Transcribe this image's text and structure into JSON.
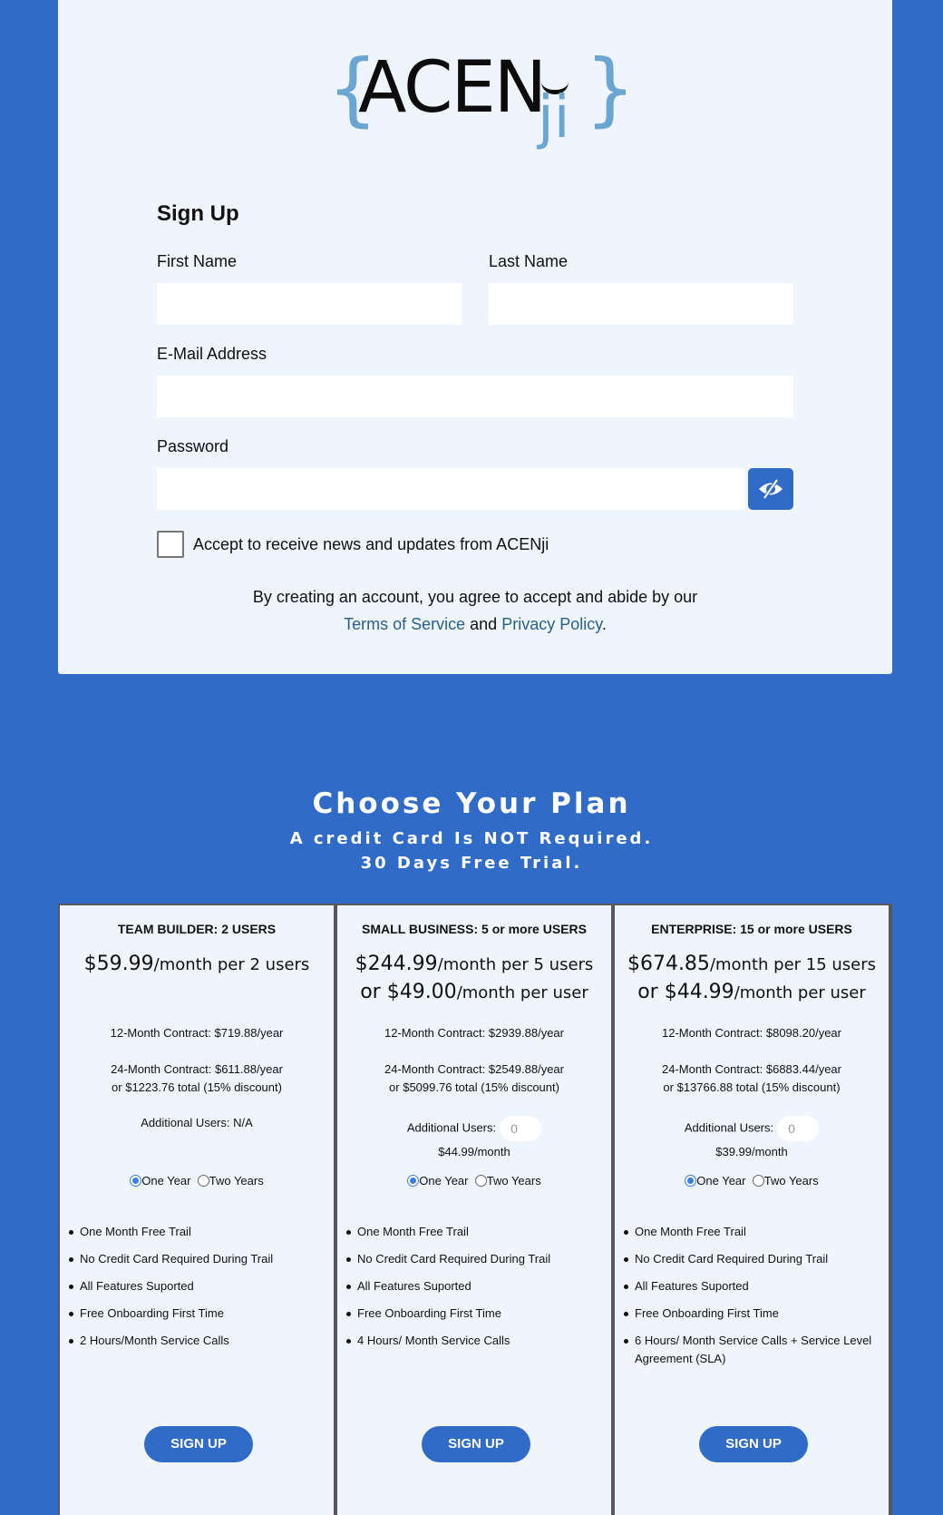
{
  "logo": {
    "brace_left": "{",
    "word": "ACEN",
    "ji": "ji",
    "brace_right": "}"
  },
  "form": {
    "title": "Sign Up",
    "first_name_label": "First Name",
    "last_name_label": "Last Name",
    "email_label": "E-Mail Address",
    "password_label": "Password",
    "first_name_value": "",
    "last_name_value": "",
    "email_value": "",
    "password_value": "",
    "checkbox_label": "Accept to receive news and updates from ACENji",
    "agree_line1": "By creating an account, you agree to accept and abide by our",
    "terms_link": "Terms of Service",
    "and": "and",
    "privacy_link": "Privacy Policy",
    "period": "."
  },
  "plans_section": {
    "title": "Choose Your Plan",
    "subtitle1": "A credit Card Is NOT Required.",
    "subtitle2": "30 Days Free Trial."
  },
  "plans": [
    {
      "name": "TEAM BUILDER: 2 USERS",
      "price_line1_amount": "$59.99",
      "price_line1_per": "/month per 2 users",
      "price_line2_amount": "",
      "price_line2_per": "",
      "contract12": "12-Month Contract: $719.88/year",
      "contract24": "24-Month Contract: $611.88/year",
      "contract24_total": "or $1223.76 total (15% discount)",
      "additional_label": "Additional Users: N/A",
      "additional_value": "",
      "additional_price": "",
      "radio_one": "One Year",
      "radio_two": "Two Years",
      "features": [
        "One Month Free Trail",
        "No Credit Card Required During Trail",
        "All Features Suported",
        "Free Onboarding First Time",
        "2 Hours/Month Service Calls"
      ],
      "button": "SIGN UP"
    },
    {
      "name": "SMALL BUSINESS: 5 or more USERS",
      "price_line1_amount": "$244.99",
      "price_line1_per": "/month per 5 users",
      "price_line2_amount": "or $49.00",
      "price_line2_per": "/month per user",
      "contract12": "12-Month Contract: $2939.88/year",
      "contract24": "24-Month Contract: $2549.88/year",
      "contract24_total": "or $5099.76 total (15% discount)",
      "additional_label": "Additional Users:",
      "additional_value": "0",
      "additional_price": "$44.99/month",
      "radio_one": "One Year",
      "radio_two": "Two Years",
      "features": [
        "One Month Free Trail",
        "No Credit Card Required During Trail",
        "All Features Suported",
        "Free Onboarding First Time",
        "4 Hours/ Month Service Calls"
      ],
      "button": "SIGN UP"
    },
    {
      "name": "ENTERPRISE: 15 or more USERS",
      "price_line1_amount": "$674.85",
      "price_line1_per": "/month per 15 users",
      "price_line2_amount": "or $44.99",
      "price_line2_per": "/month per user",
      "contract12": "12-Month Contract: $8098.20/year",
      "contract24": "24-Month Contract: $6883.44/year",
      "contract24_total": "or $13766.88 total (15% discount)",
      "additional_label": "Additional Users:",
      "additional_value": "0",
      "additional_price": "$39.99/month",
      "radio_one": "One Year",
      "radio_two": "Two Years",
      "features": [
        "One Month Free Trail",
        "No Credit Card Required During Trail",
        "All Features Suported",
        "Free Onboarding First Time",
        "6 Hours/ Month Service Calls + Service Level Agreement (SLA)"
      ],
      "button": "SIGN UP"
    }
  ]
}
